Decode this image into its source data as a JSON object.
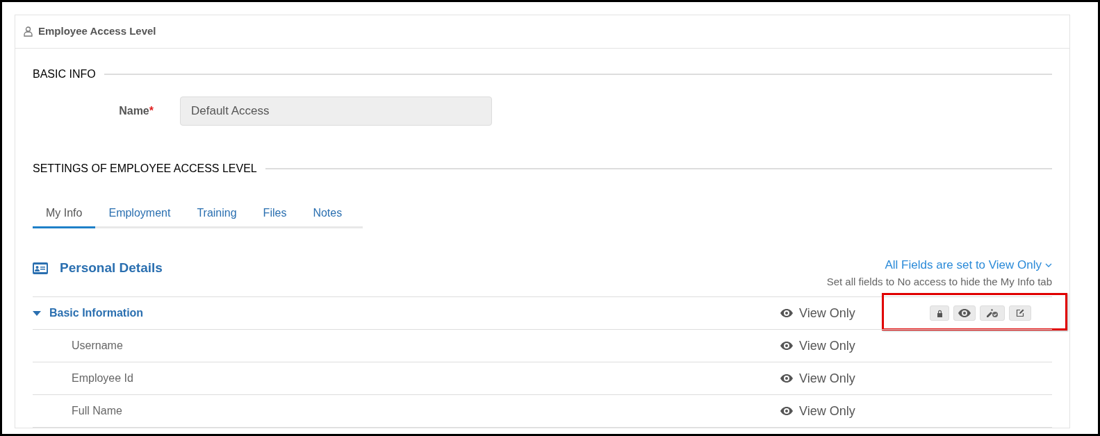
{
  "panel": {
    "title": "Employee Access Level"
  },
  "basic_info": {
    "heading": "BASIC INFO",
    "name_label": "Name",
    "required_mark": "*",
    "name_value": "Default Access"
  },
  "settings": {
    "heading": "SETTINGS OF EMPLOYEE ACCESS LEVEL"
  },
  "tabs": [
    {
      "label": "My Info",
      "selected": true
    },
    {
      "label": "Employment",
      "selected": false
    },
    {
      "label": "Training",
      "selected": false
    },
    {
      "label": "Files",
      "selected": false
    },
    {
      "label": "Notes",
      "selected": false
    }
  ],
  "section": {
    "title": "Personal Details",
    "bulk_link": "All Fields are set to View Only",
    "hint": "Set all fields to No access to hide the My Info tab"
  },
  "rows": [
    {
      "kind": "group",
      "label": "Basic Information",
      "expanded": true,
      "access": "View Only",
      "hovered": true,
      "highlighted": true
    },
    {
      "kind": "field",
      "label": "Username",
      "access": "View Only",
      "hovered": false,
      "highlighted": false
    },
    {
      "kind": "field",
      "label": "Employee Id",
      "access": "View Only",
      "hovered": false,
      "highlighted": false
    },
    {
      "kind": "field",
      "label": "Full Name",
      "access": "View Only",
      "hovered": false,
      "highlighted": false
    }
  ]
}
